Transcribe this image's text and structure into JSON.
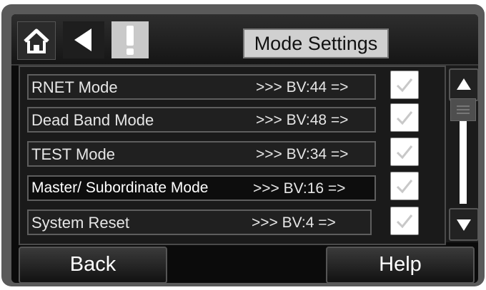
{
  "header": {
    "title": "Mode Settings",
    "icons": [
      "home-icon",
      "left-arrow-icon",
      "exclamation-icon"
    ]
  },
  "modes": [
    {
      "label": "RNET Mode",
      "value": ">>> BV:44  =>",
      "checked": true
    },
    {
      "label": "Dead Band Mode",
      "value": ">>> BV:48  =>",
      "checked": true
    },
    {
      "label": "TEST Mode",
      "value": ">>> BV:34  =>",
      "checked": true
    },
    {
      "label": "Master/ Subordinate Mode",
      "value": ">>> BV:16  =>",
      "checked": true
    },
    {
      "label": "System Reset",
      "value": ">>> BV:4    =>",
      "checked": true
    }
  ],
  "scrollbar": {
    "up_icon": "triangle-up-icon",
    "down_icon": "triangle-down-icon"
  },
  "footer": {
    "back_label": "Back",
    "help_label": "Help"
  },
  "colors": {
    "screen_bg": "#0b0b0b",
    "frame": "#5a5a5a",
    "title_bg": "#d0d0d0"
  }
}
